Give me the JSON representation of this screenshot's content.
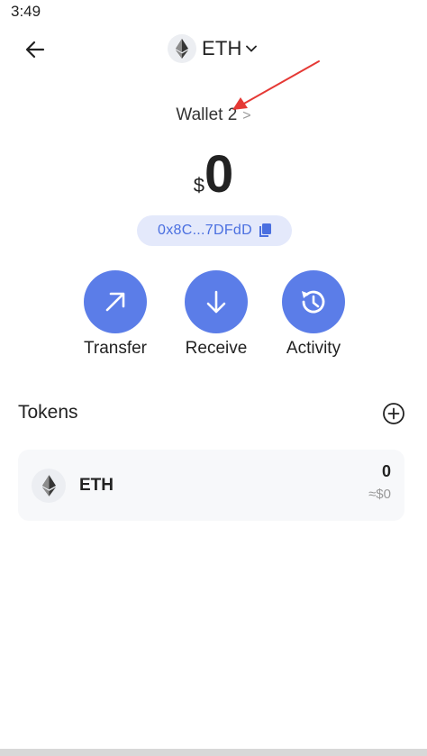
{
  "status_bar": {
    "time": "3:49"
  },
  "header": {
    "chain_label": "ETH"
  },
  "wallet": {
    "name": "Wallet 2",
    "chevron": ">"
  },
  "balance": {
    "currency": "$",
    "amount": "0"
  },
  "address": {
    "short": "0x8C...7DFdD"
  },
  "actions": [
    {
      "label": "Transfer",
      "icon": "arrow-up-right-icon"
    },
    {
      "label": "Receive",
      "icon": "arrow-down-icon"
    },
    {
      "label": "Activity",
      "icon": "history-icon"
    }
  ],
  "tokens": {
    "title": "Tokens",
    "items": [
      {
        "symbol": "ETH",
        "balance": "0",
        "fiat": "≈$0"
      }
    ]
  },
  "colors": {
    "accent": "#5b7de8",
    "pill_bg": "#e4e9fb",
    "pill_text": "#4a6fe0",
    "annotation": "#e53935"
  }
}
